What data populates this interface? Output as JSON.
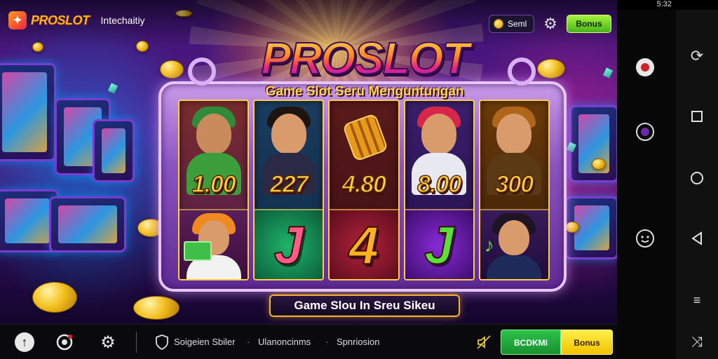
{
  "status_bar": {
    "time": "5:32"
  },
  "top_bar": {
    "brand_name": "PROSLOT",
    "brand_subtitle": "Intechaitiy",
    "coin_label": "Seml",
    "bonus_label": "Bonus"
  },
  "game": {
    "title": "PROSLOT",
    "subtitle": "Game Slot Seru Menguntungan",
    "reels": [
      {
        "value": "1.00",
        "letter": ""
      },
      {
        "value": "227",
        "letter": "J"
      },
      {
        "value": "4.80",
        "letter": "4"
      },
      {
        "value": "8.00",
        "letter": "J"
      },
      {
        "value": "300",
        "letter": ""
      }
    ],
    "banner": "Game Slou In Sreu Sikeu"
  },
  "bottom_bar": {
    "links": [
      "Soigeien Sbiler",
      "Ulanoncinms",
      "Spnriosion"
    ],
    "green_button": "BCDKMI",
    "yellow_button": "Bonus"
  },
  "colors": {
    "accent_gold": "#ffd23c",
    "accent_green": "#2ec34a",
    "accent_yellow": "#f2c200",
    "frame_purple": "#8a54c0"
  }
}
